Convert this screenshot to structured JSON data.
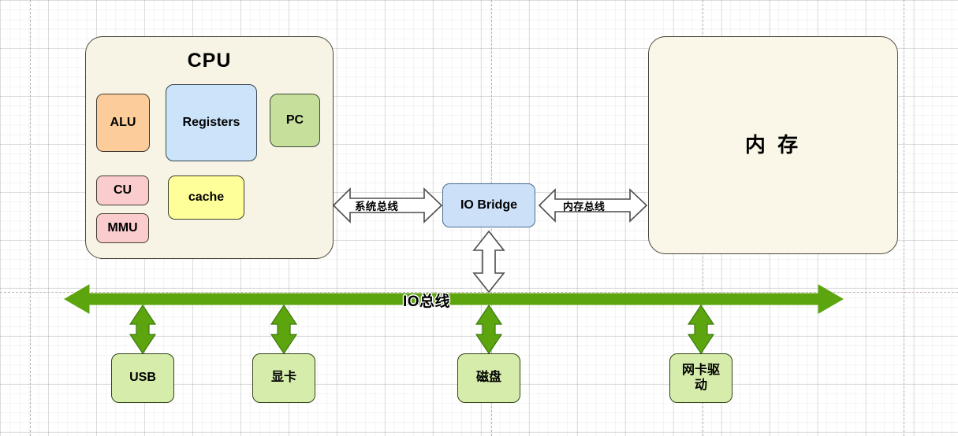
{
  "diagram": {
    "title": "Computer architecture block diagram",
    "colors": {
      "cpu_fill": "#f7f4e6",
      "memory_fill": "#faf6e8",
      "alu_fill": "#fccd9b",
      "cu_fill": "#fbcccd",
      "registers_fill": "#cce4fa",
      "pc_fill": "#c6e09b",
      "cache_fill": "#ffff99",
      "iobridge_fill": "#cce0f7",
      "device_fill": "#d6ecab",
      "io_bus_green": "#57a414",
      "outline_dark": "#4d4639"
    }
  },
  "cpu": {
    "title": "CPU",
    "units": {
      "alu": "ALU",
      "cu": "CU",
      "mmu": "MMU",
      "registers": "Registers",
      "pc": "PC",
      "cache": "cache"
    }
  },
  "memory": {
    "label": "内 存"
  },
  "io_bridge": {
    "label": "IO Bridge"
  },
  "buses": {
    "system_bus": "系统总线",
    "memory_bus": "内存总线",
    "io_bus": "IO总线"
  },
  "devices": [
    {
      "id": "usb",
      "label": "USB"
    },
    {
      "id": "gpu",
      "label": "显卡"
    },
    {
      "id": "disk",
      "label": "磁盘"
    },
    {
      "id": "nic",
      "label": "网卡驱\n动"
    }
  ]
}
